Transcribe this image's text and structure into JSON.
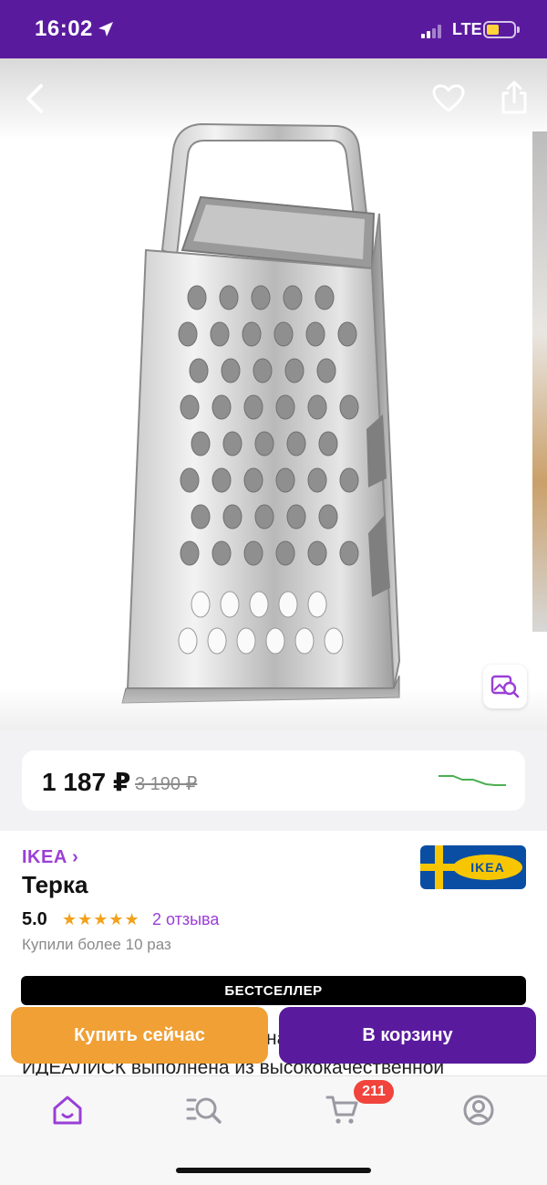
{
  "status_bar": {
    "time": "16:02",
    "network": "LTE",
    "icons": [
      "location-arrow-icon",
      "signal-icon",
      "battery-icon"
    ]
  },
  "gallery": {
    "icons": [
      "back-chevron-icon",
      "heart-icon",
      "share-icon",
      "visual-search-icon"
    ]
  },
  "price": {
    "current": "1 187 ₽",
    "old": "3 190 ₽",
    "trend_color": "#4caf50"
  },
  "product": {
    "brand": "IKEA ›",
    "brand_logo_text": "IKEA",
    "title": "Терка",
    "rating": "5.0",
    "stars": "★★★★★",
    "reviews": "2 отзыва",
    "purchased": "Купили более 10 раз",
    "badge": "БЕСТСЕЛЛЕР",
    "description_line1": "на",
    "description_line2": "ИДЕАЛИСК выполнена из высококачественной"
  },
  "actions": {
    "buy_now": "Купить сейчас",
    "add_to_cart": "В корзину"
  },
  "tab_bar": {
    "cart_count": "211",
    "active_tab": "home",
    "icons": [
      "home-icon",
      "catalog-search-icon",
      "cart-icon",
      "profile-icon"
    ]
  },
  "colors": {
    "brand_purple": "#5a1a9e",
    "link_purple": "#9a3fd6",
    "orange": "#f0a035",
    "star": "#f2a21b",
    "badge_red": "#f0443c"
  }
}
